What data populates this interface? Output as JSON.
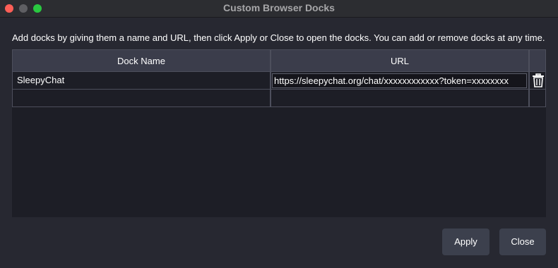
{
  "window": {
    "title": "Custom Browser Docks"
  },
  "instruction": "Add docks by giving them a name and URL, then click Apply or Close to open the docks. You can add or remove docks at any time.",
  "table": {
    "columns": [
      "Dock Name",
      "URL"
    ],
    "rows": [
      {
        "name": "SleepyChat",
        "url": "https://sleepychat.org/chat/xxxxxxxxxxxx?token=xxxxxxxx",
        "action_icon": "trash-icon"
      },
      {
        "name": "",
        "url": ""
      }
    ]
  },
  "buttons": {
    "apply": "Apply",
    "close": "Close"
  },
  "colors": {
    "close_light": "#fe5f57",
    "minimize_light": "#5f5f63",
    "maximize_light": "#29c840",
    "header_bg": "#3b3d4b",
    "button_bg": "#3c404d"
  }
}
